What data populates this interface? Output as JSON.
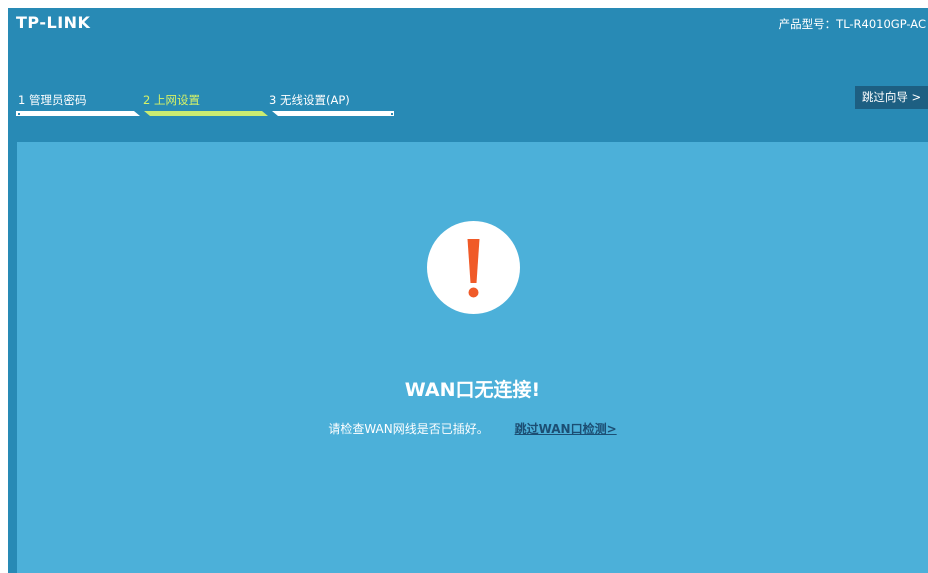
{
  "header": {
    "logo": "TP-LINK",
    "model_label": "产品型号：",
    "model_value": "TL-R4010GP-AC"
  },
  "wizard": {
    "steps": [
      {
        "label": "1 管理员密码",
        "active": false
      },
      {
        "label": "2 上网设置",
        "active": true
      },
      {
        "label": "3 无线设置(AP)",
        "active": false
      }
    ],
    "skip_label": "跳过向导 >"
  },
  "alert": {
    "icon": "exclamation-icon",
    "icon_color": "#f05a28",
    "title": "WAN口无连接!",
    "description": "请检查WAN网线是否已插好。",
    "link_label": "跳过WAN口检测>"
  },
  "colors": {
    "header_bg": "#288ab5",
    "content_bg": "#4cb0d9",
    "active_step": "#c9ec72",
    "skip_button_bg": "#1d5f82",
    "link": "#1c4e73"
  }
}
